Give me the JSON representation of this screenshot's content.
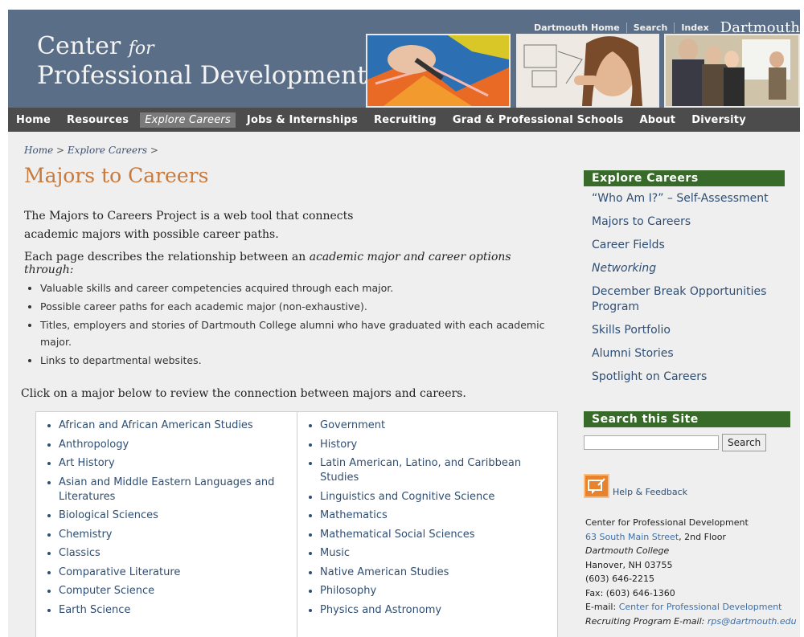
{
  "header": {
    "logo_line1_a": "Center",
    "logo_line1_b": "for",
    "logo_line2": "Professional Development",
    "utility": [
      "Dartmouth Home",
      "Search",
      "Index"
    ],
    "brand": "Dartmouth"
  },
  "nav": [
    "Home",
    "Resources",
    "Explore Careers",
    "Jobs & Internships",
    "Recruiting",
    "Grad & Professional Schools",
    "About",
    "Diversity"
  ],
  "breadcrumb": {
    "home": "Home",
    "sep": ">",
    "current": "Explore Careers"
  },
  "page": {
    "title": "Majors to Careers",
    "intro_line1": "The Majors to Careers Project is a web tool that connects",
    "intro_line2": "academic majors with possible career paths.",
    "desc_a": "Each page describes the relationship between an ",
    "desc_b": "academic major and career options through:",
    "bullets": [
      "Valuable skills and career competencies acquired through each major.",
      "Possible career paths for each academic major (non-exhaustive).",
      "Titles, employers and stories of Dartmouth College alumni who have graduated with each academic major.",
      "Links to departmental websites."
    ],
    "click_text": "Click on a major below to review the connection between majors and careers."
  },
  "majors_left": [
    "African and African American Studies",
    "Anthropology",
    "Art History",
    "Asian and Middle Eastern Languages and Literatures",
    "Biological Sciences",
    "Chemistry",
    "Classics",
    "Comparative Literature",
    "Computer Science",
    "Earth Science"
  ],
  "majors_right": [
    "Government",
    "History",
    "Latin American, Latino, and Caribbean Studies",
    "Linguistics and Cognitive Science",
    "Mathematics",
    "Mathematical Social Sciences",
    "Music",
    "Native American Studies",
    "Philosophy",
    "Physics and Astronomy"
  ],
  "sidebar": {
    "heading": "Explore Careers",
    "links": [
      "“Who Am I?” – Self-Assessment",
      "Majors to Careers",
      "Career Fields",
      "Networking",
      "December Break Opportunities Program",
      "Skills Portfolio",
      "Alumni Stories",
      "Spotlight on Careers"
    ]
  },
  "search": {
    "heading": "Search this Site",
    "button": "Search",
    "value": ""
  },
  "help": {
    "label": "Help & Feedback"
  },
  "address": {
    "org": "Center for Professional Development",
    "street_link": "63 South Main Street",
    "street_rest": ", 2nd Floor",
    "college": "Dartmouth College",
    "city": "Hanover, NH 03755",
    "phone": "(603) 646-2215",
    "fax": "Fax: (603) 646-1360",
    "email_label": "E-mail: ",
    "email_link": "Center for Professional Development",
    "recruit_label": "Recruiting Program E-mail: ",
    "recruit_link": "rps@dartmouth.edu"
  }
}
